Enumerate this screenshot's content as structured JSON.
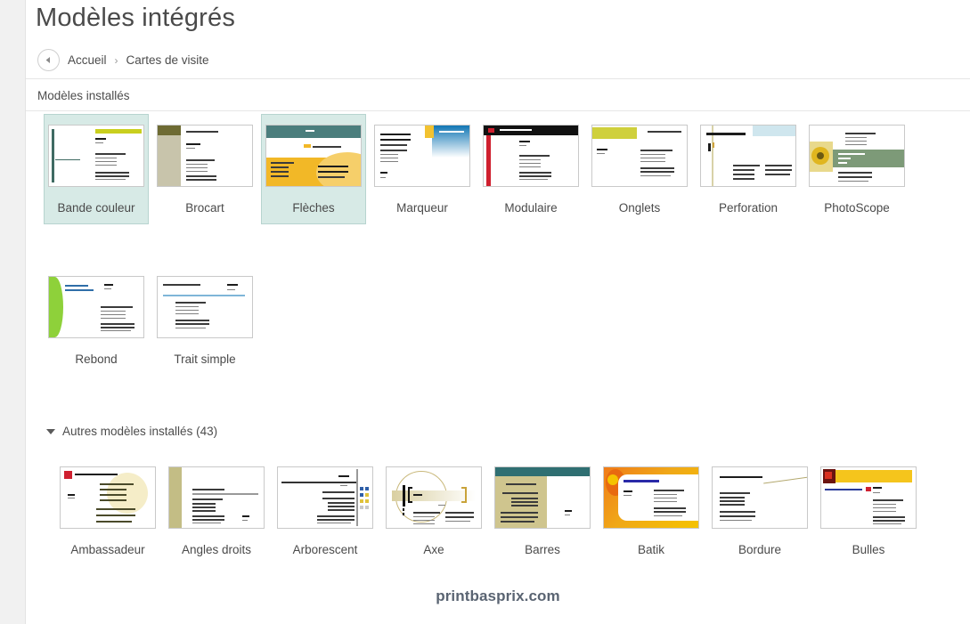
{
  "header": {
    "title": "Modèles intégrés",
    "back_icon": "back-arrow-icon",
    "breadcrumb": [
      {
        "label": "Accueil"
      },
      {
        "label": "Cartes de visite"
      }
    ],
    "breadcrumb_separator": "›"
  },
  "installed_section": {
    "title": "Modèles installés",
    "templates": [
      {
        "name": "Bande couleur",
        "selected": true,
        "style": "bande-couleur"
      },
      {
        "name": "Brocart",
        "selected": false,
        "style": "brocart"
      },
      {
        "name": "Flèches",
        "selected": true,
        "style": "fleches"
      },
      {
        "name": "Marqueur",
        "selected": false,
        "style": "marqueur"
      },
      {
        "name": "Modulaire",
        "selected": false,
        "style": "modulaire"
      },
      {
        "name": "Onglets",
        "selected": false,
        "style": "onglets"
      },
      {
        "name": "Perforation",
        "selected": false,
        "style": "perforation"
      },
      {
        "name": "PhotoScope",
        "selected": false,
        "style": "photoscope"
      },
      {
        "name": "Rebond",
        "selected": false,
        "style": "rebond"
      },
      {
        "name": "Trait simple",
        "selected": false,
        "style": "trait-simple"
      }
    ]
  },
  "other_section": {
    "title": "Autres modèles installés (43)",
    "expanded": true,
    "toggle_icon": "triangle-down-icon",
    "templates": [
      {
        "name": "Ambassadeur",
        "style": "ambassadeur"
      },
      {
        "name": "Angles droits",
        "style": "angles-droits"
      },
      {
        "name": "Arborescent",
        "style": "arborescent"
      },
      {
        "name": "Axe",
        "style": "axe"
      },
      {
        "name": "Barres",
        "style": "barres"
      },
      {
        "name": "Batik",
        "style": "batik"
      },
      {
        "name": "Bordure",
        "style": "bordure"
      },
      {
        "name": "Bulles",
        "style": "bulles"
      }
    ]
  },
  "watermark": {
    "text": "printbasprix.com"
  },
  "colors": {
    "selection_bg": "#d7eae6",
    "selection_border": "#b7d4cf",
    "page_bg": "#ffffff",
    "gutter": "#f1f1f1",
    "text": "#4a4a4a",
    "divider": "#e6e6e6",
    "watermark": "#5a6472"
  }
}
